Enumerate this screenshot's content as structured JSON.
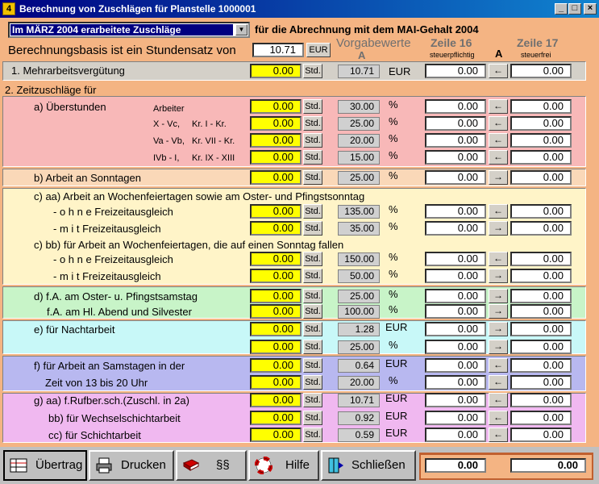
{
  "window": {
    "title": "Berechnung von Zuschlägen für Planstelle 1000001",
    "icon": "4"
  },
  "header": {
    "combo_value": "Im MÄRZ 2004 erarbeitete Zuschläge",
    "abrechnung_label": "für die Abrechnung mit dem MAI-Gehalt 2004",
    "basis_label": "Berechnungsbasis ist ein Stundensatz von",
    "basis_value": "10.71",
    "basis_unit": "EUR",
    "vorgabe_label": "Vorgabewerte",
    "vorgabe_a": "A",
    "zeile16": "Zeile 16",
    "zeile16_sub": "steuerpflichtig",
    "col_a": "A",
    "zeile17": "Zeile 17",
    "zeile17_sub": "steuerfrei"
  },
  "section1": {
    "label": "1. Mehrarbeitsvergütung",
    "value": "0.00",
    "std": "Std.",
    "vorgabe": "10.71",
    "unit": "EUR",
    "z16": "0.00",
    "arrow": "←",
    "z17": "0.00"
  },
  "section2_label": "2. Zeitzuschläge für",
  "rows": [
    {
      "label": "a) Überstunden",
      "sub1": "Arbeiter",
      "sub2": "",
      "value": "0.00",
      "std": "Std.",
      "vorgabe": "30.00",
      "unit": "%",
      "z16": "0.00",
      "arrow": "←",
      "z17": "0.00"
    },
    {
      "label": "",
      "sub1": "X - Vc,",
      "sub2": "Kr. I    - Kr.",
      "value": "0.00",
      "std": "Std.",
      "vorgabe": "25.00",
      "unit": "%",
      "z16": "0.00",
      "arrow": "←",
      "z17": "0.00"
    },
    {
      "label": "",
      "sub1": "Va - Vb,",
      "sub2": "Kr. VII  - Kr.",
      "value": "0.00",
      "std": "Std.",
      "vorgabe": "20.00",
      "unit": "%",
      "z16": "0.00",
      "arrow": "←",
      "z17": "0.00"
    },
    {
      "label": "",
      "sub1": "IVb - I,",
      "sub2": "Kr. IX   - XIII",
      "value": "0.00",
      "std": "Std.",
      "vorgabe": "15.00",
      "unit": "%",
      "z16": "0.00",
      "arrow": "←",
      "z17": "0.00"
    },
    {
      "label": "b) Arbeit an Sonntagen",
      "sub1": "",
      "sub2": "",
      "value": "0.00",
      "std": "Std.",
      "vorgabe": "25.00",
      "unit": "%",
      "z16": "0.00",
      "arrow": "→",
      "z17": "0.00"
    },
    {
      "label": "- o h n e    Freizeitausgleich",
      "sub1": "",
      "sub2": "",
      "value": "0.00",
      "std": "Std.",
      "vorgabe": "135.00",
      "unit": "%",
      "z16": "0.00",
      "arrow": "←",
      "z17": "0.00"
    },
    {
      "label": "- m i t       Freizeitausgleich",
      "sub1": "",
      "sub2": "",
      "value": "0.00",
      "std": "Std.",
      "vorgabe": "35.00",
      "unit": "%",
      "z16": "0.00",
      "arrow": "→",
      "z17": "0.00"
    },
    {
      "label": "- o h n e    Freizeitausgleich",
      "sub1": "",
      "sub2": "",
      "value": "0.00",
      "std": "Std.",
      "vorgabe": "150.00",
      "unit": "%",
      "z16": "0.00",
      "arrow": "←",
      "z17": "0.00"
    },
    {
      "label": "- m i t       Freizeitausgleich",
      "sub1": "",
      "sub2": "",
      "value": "0.00",
      "std": "Std.",
      "vorgabe": "50.00",
      "unit": "%",
      "z16": "0.00",
      "arrow": "→",
      "z17": "0.00"
    },
    {
      "label": "d) f.A. am Oster- u. Pfingstsamstag",
      "sub1": "",
      "sub2": "",
      "value": "0.00",
      "std": "Std.",
      "vorgabe": "25.00",
      "unit": "%",
      "z16": "0.00",
      "arrow": "→",
      "z17": "0.00"
    },
    {
      "label": "f.A. am Hl. Abend und Silvester",
      "sub1": "",
      "sub2": "",
      "value": "0.00",
      "std": "Std.",
      "vorgabe": "100.00",
      "unit": "%",
      "z16": "0.00",
      "arrow": "→",
      "z17": "0.00"
    },
    {
      "label": "e) für Nachtarbeit",
      "sub1": "",
      "sub2": "",
      "value": "0.00",
      "std": "Std.",
      "vorgabe": "1.28",
      "unit": "EUR",
      "z16": "0.00",
      "arrow": "→",
      "z17": "0.00"
    },
    {
      "label": "",
      "sub1": "",
      "sub2": "",
      "value": "0.00",
      "std": "Std.",
      "vorgabe": "25.00",
      "unit": "%",
      "z16": "0.00",
      "arrow": "→",
      "z17": "0.00"
    },
    {
      "label": "f) für Arbeit an Samstagen in der",
      "sub1": "",
      "sub2": "",
      "value": "0.00",
      "std": "Std.",
      "vorgabe": "0.64",
      "unit": "EUR",
      "z16": "0.00",
      "arrow": "←",
      "z17": "0.00"
    },
    {
      "label": "Zeit von 13 bis 20 Uhr",
      "sub1": "",
      "sub2": "",
      "value": "0.00",
      "std": "Std.",
      "vorgabe": "20.00",
      "unit": "%",
      "z16": "0.00",
      "arrow": "←",
      "z17": "0.00"
    },
    {
      "label": "g) aa) f.Rufber.sch.(Zuschl. in 2a)",
      "sub1": "",
      "sub2": "",
      "value": "0.00",
      "std": "Std.",
      "vorgabe": "10.71",
      "unit": "EUR",
      "z16": "0.00",
      "arrow": "←",
      "z17": "0.00"
    },
    {
      "label": "bb) für Wechselschichtarbeit",
      "sub1": "",
      "sub2": "",
      "value": "0.00",
      "std": "Std.",
      "vorgabe": "0.92",
      "unit": "EUR",
      "z16": "0.00",
      "arrow": "←",
      "z17": "0.00"
    },
    {
      "label": "cc) für Schichtarbeit",
      "sub1": "",
      "sub2": "",
      "value": "0.00",
      "std": "Std.",
      "vorgabe": "0.59",
      "unit": "EUR",
      "z16": "0.00",
      "arrow": "←",
      "z17": "0.00"
    }
  ],
  "subheads": {
    "c_aa": "c) aa) Arbeit an Wochenfeiertagen sowie am Oster- und Pfingstsonntag",
    "c_bb": "c) bb) für Arbeit an Wochenfeiertagen, die auf einen Sonntag fallen"
  },
  "footer": {
    "uebertrag": "Übertrag",
    "drucken": "Drucken",
    "paragraphs": "§§",
    "hilfe": "Hilfe",
    "schliessen": "Schließen",
    "total16": "0.00",
    "total17": "0.00"
  },
  "colors": {
    "a": "#f8b8b8",
    "b": "#fad8b8",
    "c": "#fff4c8",
    "d": "#c8f4c8",
    "e": "#c8f8f8",
    "f": "#b8b8f0",
    "g": "#f0b8f0"
  }
}
